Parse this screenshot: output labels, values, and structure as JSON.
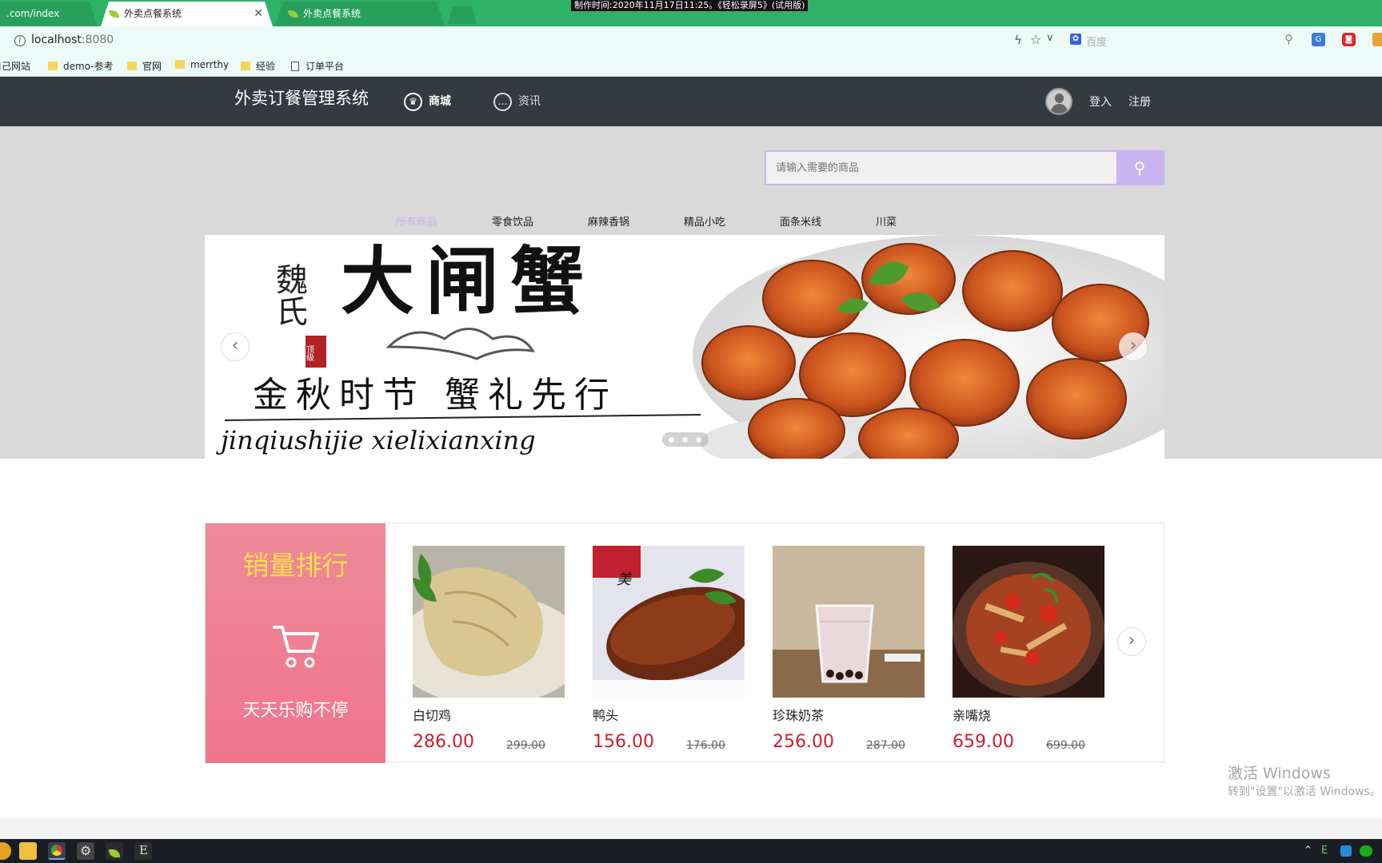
{
  "recording_banner": "制作时间:2020年11月17日11:25。《轻松录屏5》(试用版)",
  "tabs": [
    {
      "label": ".com/index"
    },
    {
      "label": "外卖点餐系统"
    },
    {
      "label": "外卖点餐系统"
    }
  ],
  "address": {
    "host": "localhost",
    "port": ":8080"
  },
  "browser_search": {
    "placeholder": "百度"
  },
  "bookmarks": [
    {
      "label": "自己网站"
    },
    {
      "label": "demo-参考"
    },
    {
      "label": "官网"
    },
    {
      "label": "merrthy"
    },
    {
      "label": "经验"
    },
    {
      "label": "订单平台"
    }
  ],
  "header": {
    "brand": "外卖订餐管理系统",
    "nav": [
      {
        "label": "商城"
      },
      {
        "label": "资讯"
      }
    ],
    "login": "登入",
    "register": "注册"
  },
  "search": {
    "placeholder": "请输入需要的商品"
  },
  "categories": [
    {
      "label": "所有商品",
      "active": true
    },
    {
      "label": "零食饮品"
    },
    {
      "label": "麻辣香锅"
    },
    {
      "label": "精品小吃"
    },
    {
      "label": "面条米线"
    },
    {
      "label": "川菜"
    }
  ],
  "banner": {
    "brand_small": "魏氏",
    "headline": "大闸蟹",
    "seal": "顶级",
    "slogan": "金秋时节 蟹礼先行",
    "pinyin": "jinqiushijie xielixianxing",
    "slide_index": 1,
    "slide_count": 3
  },
  "sales": {
    "title": "销量排行",
    "subtitle": "天天乐购不停",
    "products": [
      {
        "name": "白切鸡",
        "price": "286.00",
        "old_price": "299.00"
      },
      {
        "name": "鸭头",
        "price": "156.00",
        "old_price": "176.00"
      },
      {
        "name": "珍珠奶茶",
        "price": "256.00",
        "old_price": "287.00"
      },
      {
        "name": "亲嘴烧",
        "price": "659.00",
        "old_price": "699.00"
      }
    ]
  },
  "watermark": {
    "line1": "激活 Windows",
    "line2": "转到\"设置\"以激活 Windows。"
  },
  "colors": {
    "accent": "#c9b3f0",
    "header_bg": "#343a40",
    "price": "#c91f2c",
    "tabbar": "#2fb167",
    "promo": "#f0758c"
  },
  "icons": {
    "nav_mall": "crown-icon",
    "nav_news": "chat-icon",
    "search": "search-icon",
    "carousel_prev": "chevron-left-icon",
    "carousel_next": "chevron-right-icon",
    "cart": "cart-icon"
  }
}
